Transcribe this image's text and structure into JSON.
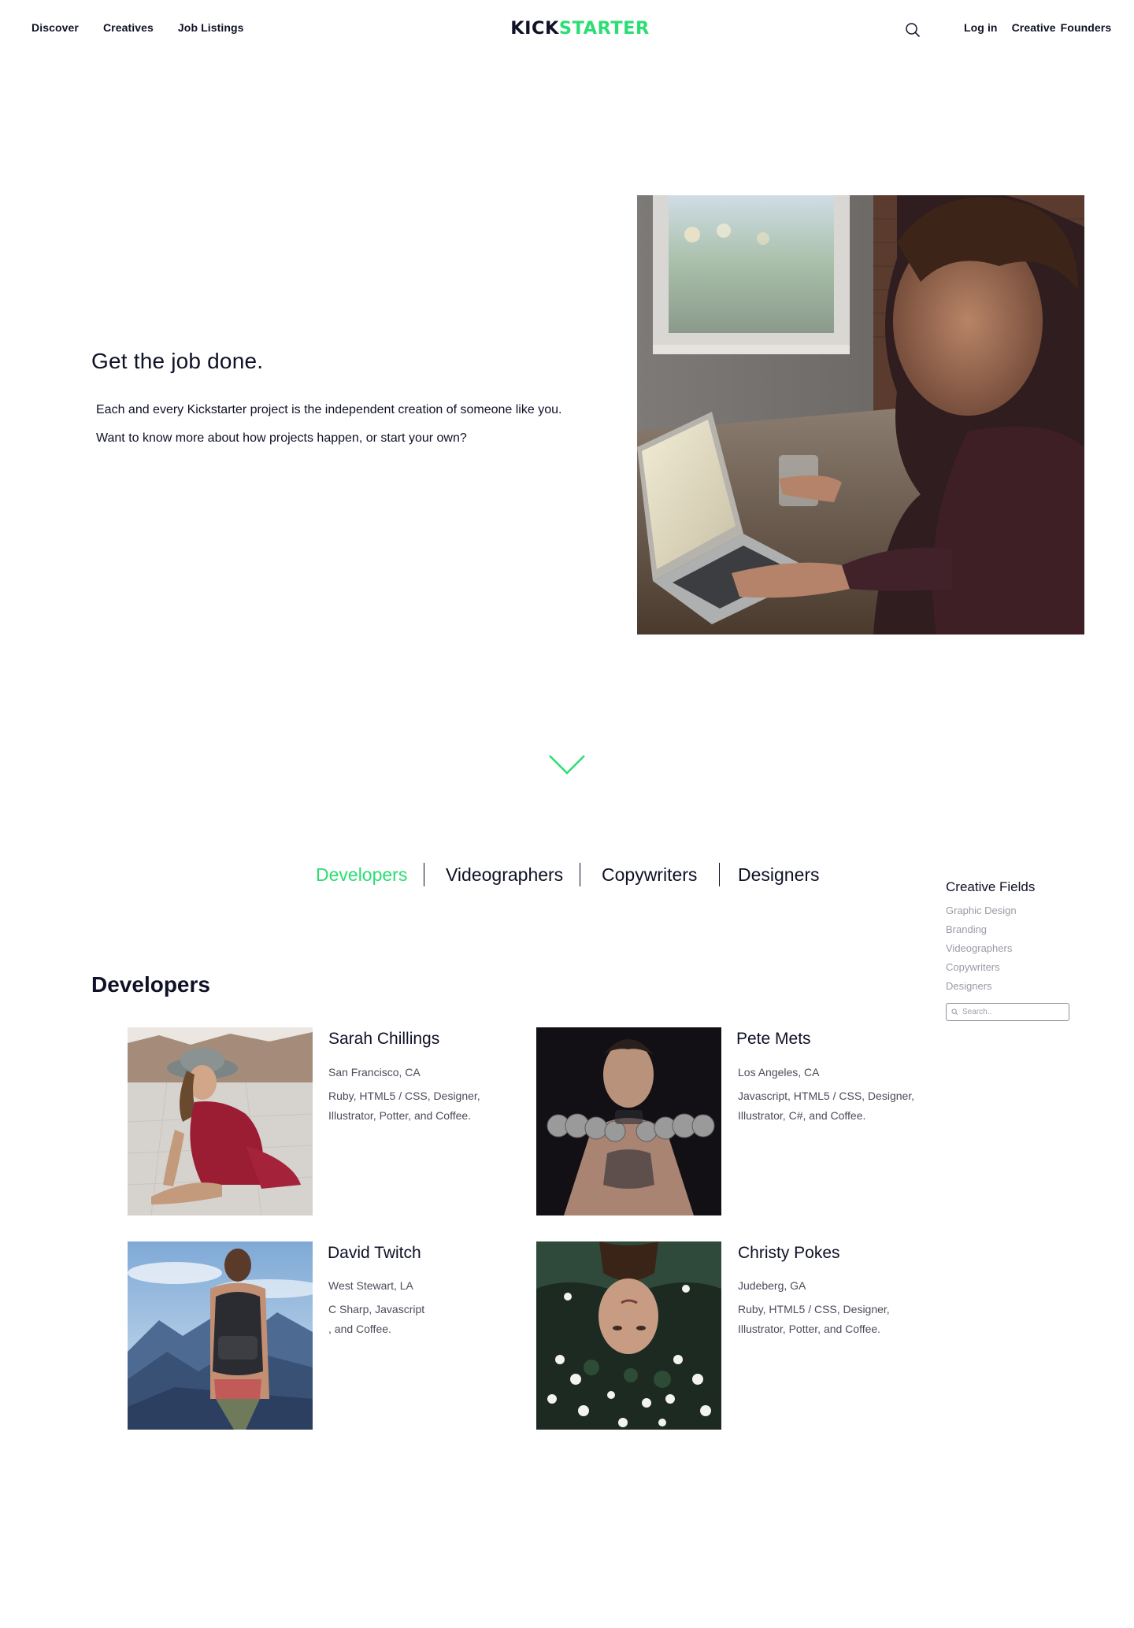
{
  "nav": {
    "left": [
      "Discover",
      "Creatives",
      "Job Listings"
    ],
    "logo_dark": "KICK",
    "logo_green": "STARTER",
    "login": "Log in",
    "creative": "Creative",
    "founders": "Founders"
  },
  "hero": {
    "title": "Get the job done.",
    "line1": "Each and every Kickstarter project is the independent creation of someone like you.",
    "line2": "Want to know more about how projects happen, or start your own?"
  },
  "tabs": [
    "Developers",
    "Videographers",
    "Copywriters",
    "Designers"
  ],
  "sidebar": {
    "title": "Creative Fields",
    "items": [
      "Graphic Design",
      "Branding",
      "Videographers",
      "Copywriters",
      "Designers"
    ],
    "search_placeholder": "Search.."
  },
  "developers": {
    "title": "Developers",
    "cards": [
      {
        "name": "Sarah Chillings",
        "location": "San Francisco, CA",
        "skills_1": "Ruby, HTML5 / CSS, Designer,",
        "skills_2": "Illustrator, Potter, and Coffee."
      },
      {
        "name": "Pete Mets",
        "location": "Los Angeles, CA",
        "skills_1": "Javascript, HTML5 / CSS, Designer,",
        "skills_2": "Illustrator, C#, and Coffee."
      },
      {
        "name": "David Twitch",
        "location": "West Stewart, LA",
        "skills_1": "C Sharp, Javascript",
        "skills_2": ", and Coffee."
      },
      {
        "name": "Christy Pokes",
        "location": "Judeberg, GA",
        "skills_1": "Ruby, HTML5 / CSS, Designer,",
        "skills_2": "Illustrator, Potter, and Coffee."
      }
    ]
  },
  "colors": {
    "accent": "#2bde73",
    "text": "#0f1126",
    "muted": "#9a9ba6"
  }
}
